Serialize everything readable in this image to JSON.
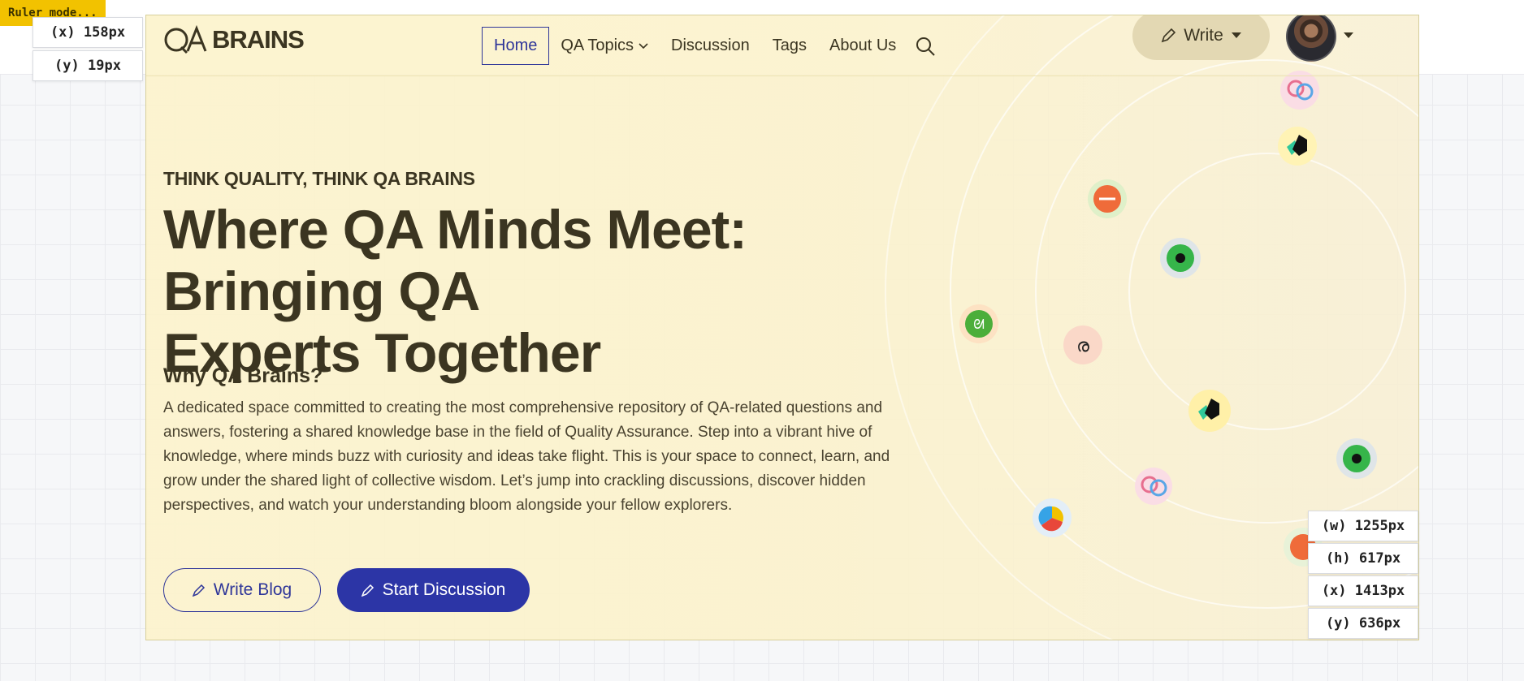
{
  "ruler": {
    "mode_label": "Ruler mode...",
    "x_top": "(x) 158px",
    "y_top": "(y) 19px",
    "w": "(w) 1255px",
    "h": "(h) 617px",
    "x_bottom": "(x) 1413px",
    "y_bottom": "(y) 636px"
  },
  "brand": {
    "logo_text": "BRAINS",
    "logo_mark": "QA"
  },
  "nav": {
    "items": [
      {
        "label": "Home",
        "active": true
      },
      {
        "label": "QA Topics",
        "has_caret": true
      },
      {
        "label": "Discussion"
      },
      {
        "label": "Tags"
      },
      {
        "label": "About Us"
      }
    ],
    "search_icon": "search-icon",
    "write_label": "Write"
  },
  "hero": {
    "kicker": "THINK QUALITY, THINK QA BRAINS",
    "title_line1": "Where QA Minds Meet: Bringing QA",
    "title_line2": "Experts Together",
    "subtitle": "Why QA Brains?",
    "paragraph": "A dedicated space committed to creating the most comprehensive repository of QA-related questions and answers, fostering a shared knowledge base in the field of Quality Assurance. Step into a vibrant hive of knowledge, where minds buzz with curiosity and ideas take flight. This is your space to connect, learn, and grow under the shared light of collective wisdom. Let’s jump into crackling discussions, discover hidden perspectives, and watch your understanding bloom alongside your fellow explorers.",
    "primary_btn": "Start Discussion",
    "secondary_btn": "Write Blog"
  },
  "colors": {
    "accent": "#2c35a6",
    "hero_bg": "#fbf2cd",
    "text": "#3b3521",
    "ruler": "#f2c200"
  }
}
